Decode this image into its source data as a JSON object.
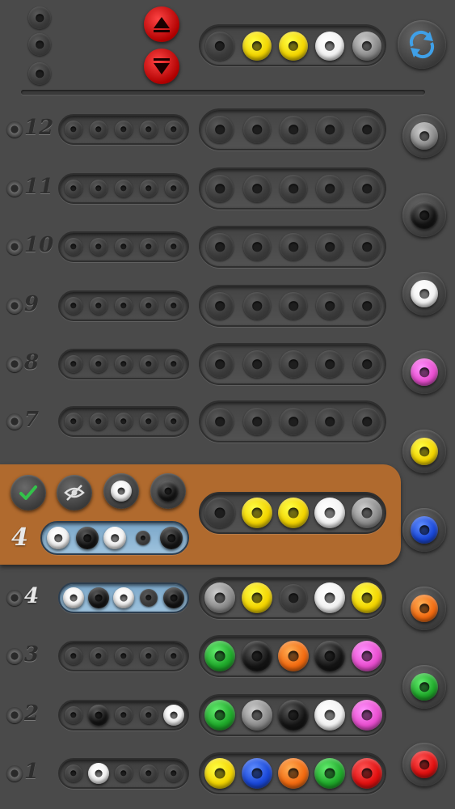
{
  "colors": {
    "yellow": "#f2d400",
    "white": "#f2f2f2",
    "gray": "#8a8a8a",
    "black": "#141414",
    "pink": "#e84ecf",
    "blue": "#1a48d8",
    "orange": "#f26a10",
    "green": "#1fa82a",
    "red": "#e01010",
    "panel": "#b06a2e"
  },
  "header": {
    "top_dots": 3,
    "secret_code": [
      "yellow",
      "yellow",
      "white",
      "gray"
    ],
    "up_icon": "triangle-up-icon",
    "down_icon": "triangle-down-icon",
    "restart_icon": "refresh-icon"
  },
  "active_row": {
    "label": "4",
    "check_icon": "check-icon",
    "hide_icon": "eye-slash-icon",
    "feedback_pegs": [
      "white",
      "black",
      "white",
      "empty",
      "black"
    ],
    "guess": [
      "empty",
      "yellow",
      "yellow",
      "white",
      "gray"
    ],
    "tool_pegs": [
      "white",
      "black"
    ]
  },
  "rows": [
    {
      "label": "12",
      "feedback": [
        "e",
        "e",
        "e",
        "e",
        "e"
      ],
      "guess": [
        "e",
        "e",
        "e",
        "e",
        "e"
      ]
    },
    {
      "label": "11",
      "feedback": [
        "e",
        "e",
        "e",
        "e",
        "e"
      ],
      "guess": [
        "e",
        "e",
        "e",
        "e",
        "e"
      ]
    },
    {
      "label": "10",
      "feedback": [
        "e",
        "e",
        "e",
        "e",
        "e"
      ],
      "guess": [
        "e",
        "e",
        "e",
        "e",
        "e"
      ]
    },
    {
      "label": "9",
      "feedback": [
        "e",
        "e",
        "e",
        "e",
        "e"
      ],
      "guess": [
        "e",
        "e",
        "e",
        "e",
        "e"
      ]
    },
    {
      "label": "8",
      "feedback": [
        "e",
        "e",
        "e",
        "e",
        "e"
      ],
      "guess": [
        "e",
        "e",
        "e",
        "e",
        "e"
      ]
    },
    {
      "label": "7",
      "feedback": [
        "e",
        "e",
        "e",
        "e",
        "e"
      ],
      "guess": [
        "e",
        "e",
        "e",
        "e",
        "e"
      ]
    },
    {
      "label": "4",
      "feedback": [
        "white",
        "black",
        "white",
        "e",
        "black"
      ],
      "guess": [
        "gray",
        "yellow",
        "e",
        "white",
        "yellow"
      ],
      "blue": true
    },
    {
      "label": "3",
      "feedback": [
        "e",
        "e",
        "e",
        "e",
        "e"
      ],
      "guess": [
        "green",
        "black",
        "orange",
        "black",
        "pink"
      ]
    },
    {
      "label": "2",
      "feedback": [
        "e",
        "black",
        "e",
        "e",
        "white"
      ],
      "guess": [
        "green",
        "gray",
        "black",
        "white",
        "pink"
      ]
    },
    {
      "label": "1",
      "feedback": [
        "e",
        "white",
        "e",
        "e",
        "e"
      ],
      "guess": [
        "yellow",
        "blue",
        "orange",
        "green",
        "red"
      ]
    }
  ],
  "palette": [
    "gray",
    "black",
    "white",
    "pink",
    "yellow",
    "blue",
    "orange",
    "green",
    "red"
  ]
}
